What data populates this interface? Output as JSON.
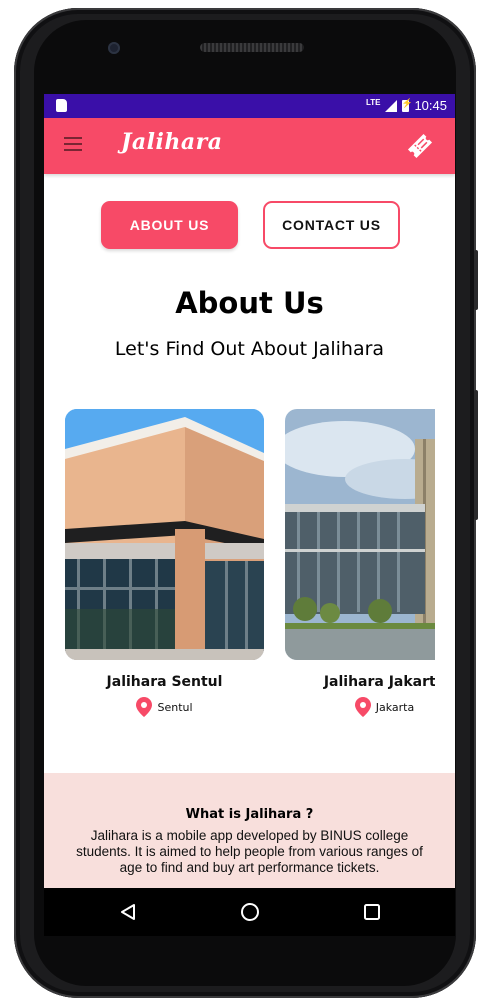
{
  "status_bar": {
    "network": "LTE",
    "time": "10:45"
  },
  "app_bar": {
    "brand": "Jalihara",
    "menu_icon": "hamburger-menu-icon",
    "action_icon": "ticket-icon"
  },
  "tabs": {
    "about_label": "ABOUT US",
    "contact_label": "CONTACT US",
    "active": "about"
  },
  "page": {
    "title": "About Us",
    "subtitle": "Let's Find Out About Jalihara"
  },
  "locations": [
    {
      "name": "Jalihara Sentul",
      "place": "Sentul",
      "icon": "location-pin-icon"
    },
    {
      "name": "Jalihara Jakarta",
      "place": "Jakarta",
      "icon": "location-pin-icon"
    }
  ],
  "info": {
    "title": "What is Jalihara ?",
    "text": "Jalihara is a mobile app developed by BINUS college students. It is aimed to help people from various ranges of age to find and buy art performance tickets."
  },
  "colors": {
    "primary": "#f74a67",
    "status_bar": "#3a0fa8",
    "info_bg": "#f8dfdc"
  },
  "nav": {
    "back_icon": "back-triangle-icon",
    "home_icon": "home-circle-icon",
    "recents_icon": "recents-square-icon"
  }
}
